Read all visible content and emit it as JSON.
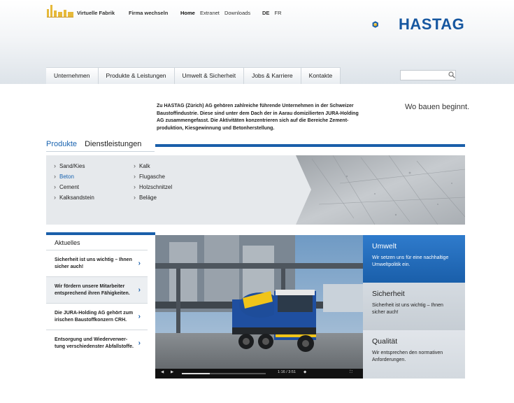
{
  "topbar": {
    "virtual_factory": "Virtuelle Fabrik",
    "switch_company": "Firma wechseln",
    "util_nav": [
      "Home",
      "Extranet",
      "Downloads"
    ],
    "languages": [
      "DE",
      "FR"
    ]
  },
  "brand": {
    "name": "HASTAG"
  },
  "mainnav": {
    "items": [
      "Unternehmen",
      "Produkte & Leistungen",
      "Umwelt & Sicherheit",
      "Jobs & Karriere",
      "Kontakte"
    ]
  },
  "search": {
    "placeholder": ""
  },
  "intro": {
    "text": "Zu HASTAG (Zürich) AG gehören zahlreiche führende Unternehmen in der Schweizer Baustoffindustrie. Diese sind unter dem Dach der in Aarau domizilierten JURA-Holding AG zusammengefasst. Die Aktivitäten konzentrieren sich auf die Bereiche Zement-produktion, Kiesgewinnung und Betonherstellung.",
    "tagline": "Wo bauen beginnt."
  },
  "tabs": {
    "products": "Produkte",
    "services": "Dienstleistungen"
  },
  "products": {
    "col1": [
      "Sand/Kies",
      "Beton",
      "Cement",
      "Kalksandstein"
    ],
    "col2": [
      "Kalk",
      "Flugasche",
      "Holzschnitzel",
      "Beläge"
    ]
  },
  "news": {
    "title": "Aktuelles",
    "items": [
      "Sicherheit ist uns wichtig – Ihnen sicher auch!",
      "Wir fördern unsere Mitarbeiter entsprechend ihren Fähigkeiten.",
      "Die JURA-Holding AG gehört zum irischen Baustoffkonzern CRH.",
      "Entsorgung und Wiederverwer-tung verschiedenster Abfallstoffe."
    ]
  },
  "video": {
    "time": "1:16 / 3:51",
    "progress": 0.33
  },
  "cards": [
    {
      "title": "Umwelt",
      "text": "Wir setzen uns für eine nachhaltige Umweltpolitik ein."
    },
    {
      "title": "Sicherheit",
      "text": "Sicherheit ist uns wichtig – Ihnen sicher auch!"
    },
    {
      "title": "Qualität",
      "text": "Wir entsprechen den normativen Anforderungen."
    }
  ],
  "colors": {
    "brand_blue": "#1a5faa",
    "accent": "#1a64b0",
    "logo_yellow": "#f2c230"
  }
}
